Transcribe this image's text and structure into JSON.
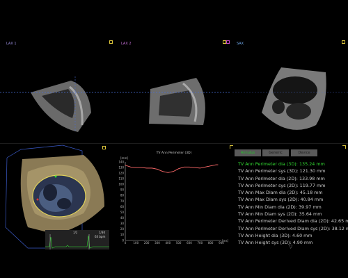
{
  "views": {
    "lax1": {
      "label": "LAX 1",
      "color": "#9b8fe0",
      "icon_color": "#d8c23a"
    },
    "lax2": {
      "label": "LAX 2",
      "color": "#c46fd6",
      "icon_color": "#d8c23a"
    },
    "sax": {
      "label": "SAX",
      "color": "#6fa6e8",
      "icon_color": "#c446c4",
      "icon2_color": "#d8c23a"
    }
  },
  "chart_data": {
    "type": "line",
    "title": "TV Ann Perimeter (3D)",
    "xlabel": "",
    "ylabel": "",
    "x_unit": "[ms]",
    "y_unit": "[mm]",
    "xlim": [
      0,
      900
    ],
    "ylim": [
      0,
      140
    ],
    "x_ticks": [
      "0",
      "100",
      "200",
      "300",
      "400",
      "500",
      "600",
      "700",
      "800",
      "900"
    ],
    "y_ticks": [
      "140",
      "130",
      "120",
      "110",
      "100",
      "90",
      "80",
      "70",
      "60",
      "50",
      "40",
      "30",
      "20",
      "10",
      "0"
    ],
    "series": [
      {
        "name": "",
        "color": "#ff6a6a",
        "x": [
          0,
          50,
          100,
          150,
          200,
          250,
          300,
          350,
          400,
          450,
          500,
          550,
          600,
          650,
          700,
          750,
          800,
          850,
          870
        ],
        "y": [
          134,
          131,
          130,
          130,
          129,
          129,
          127,
          123,
          121,
          123,
          128,
          131,
          131,
          130,
          129,
          131,
          133,
          135,
          135
        ]
      }
    ]
  },
  "volume": {
    "frame": "1/30",
    "rate": "63 bpm",
    "ecg_frame": "1/2"
  },
  "tabs": [
    "Annulus",
    "Generic",
    "Device"
  ],
  "measurements": [
    "TV Ann Perimeter dia (3D): 135.24 mm",
    "TV Ann Perimeter sys (3D): 121.30 mm",
    "TV Ann Perimeter dia (2D): 133.98 mm",
    "TV Ann Perimeter sys (2D): 119.77 mm",
    "TV Ann Max Diam dia (2D): 45.18 mm",
    "TV Ann Max Diam sys (2D): 40.84 mm",
    "TV Ann Min Diam dia (2D): 39.97 mm",
    "TV Ann Min Diam sys (2D): 35.64 mm",
    "TV Ann Perimeter Derived Diam dia (2D): 42.65 mm",
    "TV Ann Perimeter Derived Diam sys (2D): 38.12 mm",
    "TV Ann Height dia (3D): 4.60 mm",
    "TV Ann Height sys (3D): 4.90 mm"
  ]
}
